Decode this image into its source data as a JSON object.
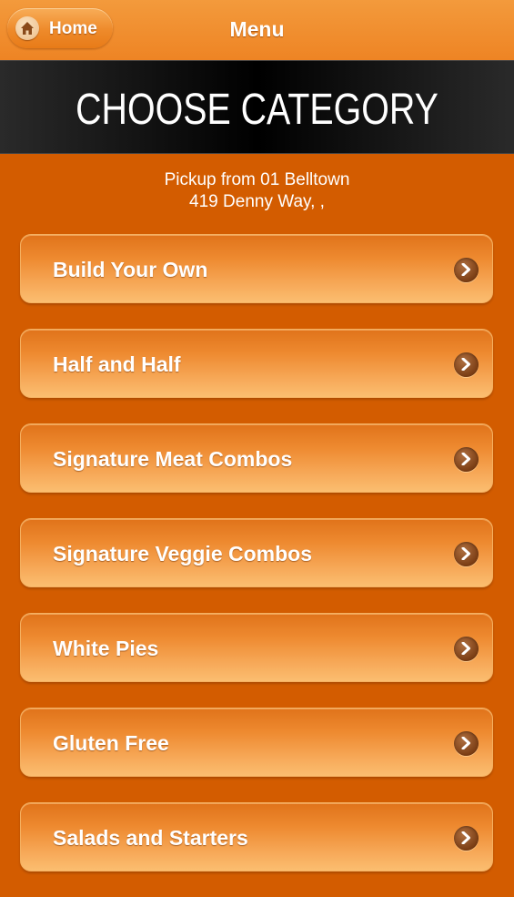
{
  "topbar": {
    "home_label": "Home",
    "title": "Menu"
  },
  "banner": {
    "title": "CHOOSE CATEGORY"
  },
  "pickup": {
    "line1": "Pickup from 01 Belltown",
    "line2": "419 Denny Way, ,"
  },
  "categories": [
    {
      "label": "Build Your Own",
      "icon": "chevron-right-icon"
    },
    {
      "label": "Half and Half",
      "icon": "chevron-right-icon"
    },
    {
      "label": "Signature Meat Combos",
      "icon": "chevron-right-icon"
    },
    {
      "label": "Signature Veggie Combos",
      "icon": "chevron-right-icon"
    },
    {
      "label": "White Pies",
      "icon": "chevron-right-icon"
    },
    {
      "label": "Gluten Free",
      "icon": "chevron-right-icon"
    },
    {
      "label": "Salads and Starters",
      "icon": "chevron-right-icon"
    }
  ],
  "colors": {
    "background": "#d35c00",
    "topbar": "#ee8424",
    "banner": "#000000",
    "button_gradient_bottom": "#fbbe70",
    "text": "#ffffff"
  }
}
